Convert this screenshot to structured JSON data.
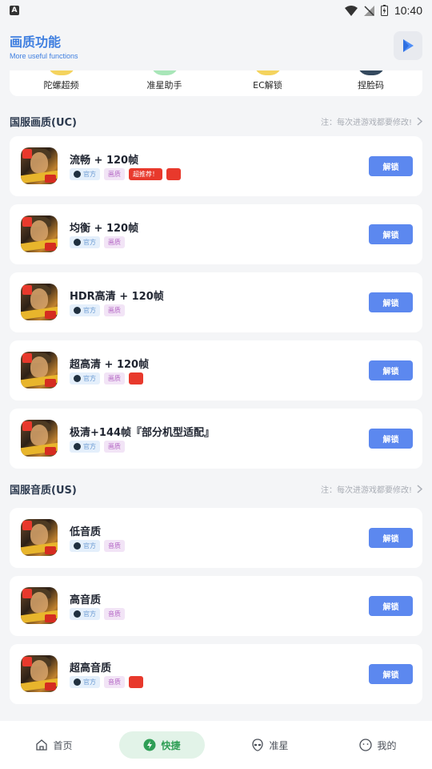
{
  "status_bar": {
    "time": "10:40",
    "left_icon": "A"
  },
  "header": {
    "title": "画质功能",
    "subtitle": "More useful functions",
    "action_icon": "play-store-icon"
  },
  "shortcuts": [
    {
      "label": "陀螺超频",
      "color": "#f4d35e"
    },
    {
      "label": "准星助手",
      "color": "#a8e6b8"
    },
    {
      "label": "EC解锁",
      "color": "#f4d35e"
    },
    {
      "label": "捏脸码",
      "color": "#34495e"
    }
  ],
  "sections": [
    {
      "title": "国服画质(UC)",
      "note": "注：每次进游戏都要修改!",
      "items": [
        {
          "name": "流畅 + 120帧",
          "chips": [
            "官方",
            "画质"
          ],
          "hot": "超推荐！",
          "red": true,
          "button": "解锁"
        },
        {
          "name": "均衡 + 120帧",
          "chips": [
            "官方",
            "画质"
          ],
          "hot": "",
          "red": false,
          "button": "解锁"
        },
        {
          "name": "HDR高清 + 120帧",
          "chips": [
            "官方",
            "画质"
          ],
          "hot": "",
          "red": false,
          "button": "解锁"
        },
        {
          "name": "超高清 + 120帧",
          "chips": [
            "官方",
            "画质"
          ],
          "hot": "",
          "red": true,
          "button": "解锁"
        },
        {
          "name": "极清+144帧『部分机型适配』",
          "chips": [
            "官方",
            "画质"
          ],
          "hot": "",
          "red": false,
          "button": "解锁"
        }
      ]
    },
    {
      "title": "国服音质(US)",
      "note": "注：每次进游戏都要修改!",
      "items": [
        {
          "name": "低音质",
          "chips": [
            "官方",
            "音质"
          ],
          "hot": "",
          "red": false,
          "button": "解锁"
        },
        {
          "name": "高音质",
          "chips": [
            "官方",
            "音质"
          ],
          "hot": "",
          "red": false,
          "button": "解锁"
        },
        {
          "name": "超高音质",
          "chips": [
            "官方",
            "音质"
          ],
          "hot": "",
          "red": true,
          "button": "解锁"
        }
      ]
    }
  ],
  "bottom_nav": [
    {
      "label": "首页",
      "icon": "home-icon",
      "active": false
    },
    {
      "label": "快捷",
      "icon": "bolt-icon",
      "active": true
    },
    {
      "label": "准星",
      "icon": "alien-icon",
      "active": false
    },
    {
      "label": "我的",
      "icon": "smile-icon",
      "active": false
    }
  ],
  "colors": {
    "accent": "#5c88ef",
    "title_blue": "#3f7fe0",
    "nav_active": "#2e9e55",
    "hot_red": "#e8392c"
  }
}
